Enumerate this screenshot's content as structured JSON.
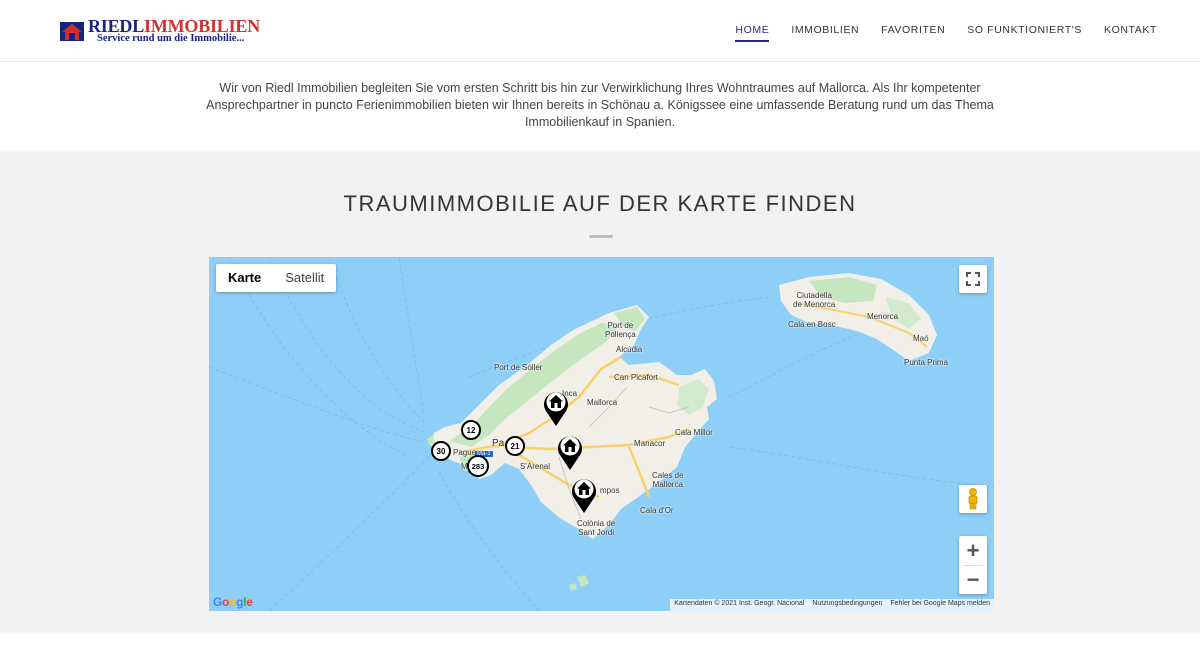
{
  "header": {
    "brand_part1": "RIEDL",
    "brand_part2": "IMMOBILIEN",
    "tagline": "Service rund um die Immobilie...",
    "nav": [
      {
        "label": "HOME",
        "active": true
      },
      {
        "label": "IMMOBILIEN",
        "active": false
      },
      {
        "label": "FAVORITEN",
        "active": false
      },
      {
        "label": "SO FUNKTIONIERT'S",
        "active": false
      },
      {
        "label": "KONTAKT",
        "active": false
      }
    ]
  },
  "intro": {
    "text": "Wir von Riedl Immobilien begleiten Sie vom ersten Schritt bis hin zur Verwirklichung Ihres Wohntraumes auf Mallorca. Als Ihr kompetenter Ansprechpartner in puncto Ferienimmobilien bieten wir Ihnen bereits in Schönau a. Königssee eine umfassende Beratung rund um das Thema Immobilienkauf in Spanien."
  },
  "map_section": {
    "title": "TRAUMIMMOBILIE AUF DER KARTE FINDEN",
    "map_type": {
      "map_label": "Karte",
      "satellite_label": "Satellit",
      "selected": "Karte"
    },
    "zoom_in": "+",
    "zoom_out": "−",
    "places": {
      "pollenca": "Port de\nPollença",
      "alcudia": "Alcúdia",
      "can_picafort": "Can Picafort",
      "port_soller": "Port de Sóller",
      "inca": "Inca",
      "mallorca": "Mallorca",
      "palma": "Pa",
      "andratx": "Paguera",
      "magaluf": "M  f",
      "s_arenal": "S'Arenal",
      "manacor": "Manacor",
      "cala_millor": "Cala Millor",
      "cales_de_mallorca": "Cales de\nMallorca",
      "campos": "mpos",
      "cala_dor": "Cala d'Or",
      "colonia_st_jordi": "Colònia de\nSant Jordi",
      "ciutadella": "Ciutadella\nde Menorca",
      "cala_en_bosc": "Cala en Bosc",
      "menorca": "Menorca",
      "mao": "Maó",
      "punta_prima": "Punta Prima"
    },
    "road_badge": "Ma-1",
    "clusters": [
      "12",
      "30",
      "283",
      "21"
    ],
    "attribution": {
      "data": "Kartendaten © 2021 Inst. Geogr. Nacional",
      "terms": "Nutzungsbedingungen",
      "report": "Fehler bei Google Maps melden"
    },
    "google_logo": "Google"
  }
}
